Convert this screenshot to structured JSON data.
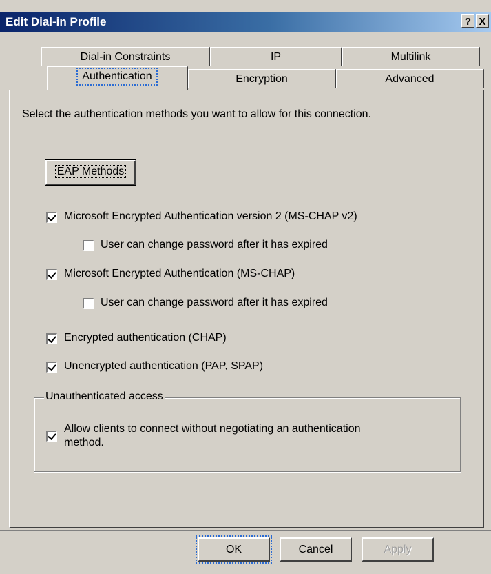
{
  "window": {
    "title": "Edit Dial-in Profile",
    "help_label": "?",
    "close_label": "X"
  },
  "tabs": {
    "row1": [
      {
        "label": "Dial-in Constraints"
      },
      {
        "label": "IP"
      },
      {
        "label": "Multilink"
      }
    ],
    "row2": [
      {
        "label": "Authentication",
        "selected": true
      },
      {
        "label": "Encryption"
      },
      {
        "label": "Advanced"
      }
    ]
  },
  "authentication": {
    "description": "Select the authentication methods you want to allow for this connection.",
    "eap_button": "EAP Methods",
    "options": [
      {
        "label": "Microsoft Encrypted Authentication version 2 (MS-CHAP v2)",
        "checked": true
      },
      {
        "label": "User can change password after it has expired",
        "checked": false
      },
      {
        "label": "Microsoft Encrypted Authentication (MS-CHAP)",
        "checked": true
      },
      {
        "label": "User can change password after it has expired",
        "checked": false
      },
      {
        "label": "Encrypted authentication (CHAP)",
        "checked": true
      },
      {
        "label": "Unencrypted authentication (PAP, SPAP)",
        "checked": true
      }
    ],
    "unauthenticated": {
      "legend": "Unauthenticated access",
      "allow_line1": "Allow clients to connect without negotiating an authentication",
      "allow_line2": "method.",
      "checked": true
    }
  },
  "buttons": {
    "ok": "OK",
    "cancel": "Cancel",
    "apply": "Apply"
  }
}
